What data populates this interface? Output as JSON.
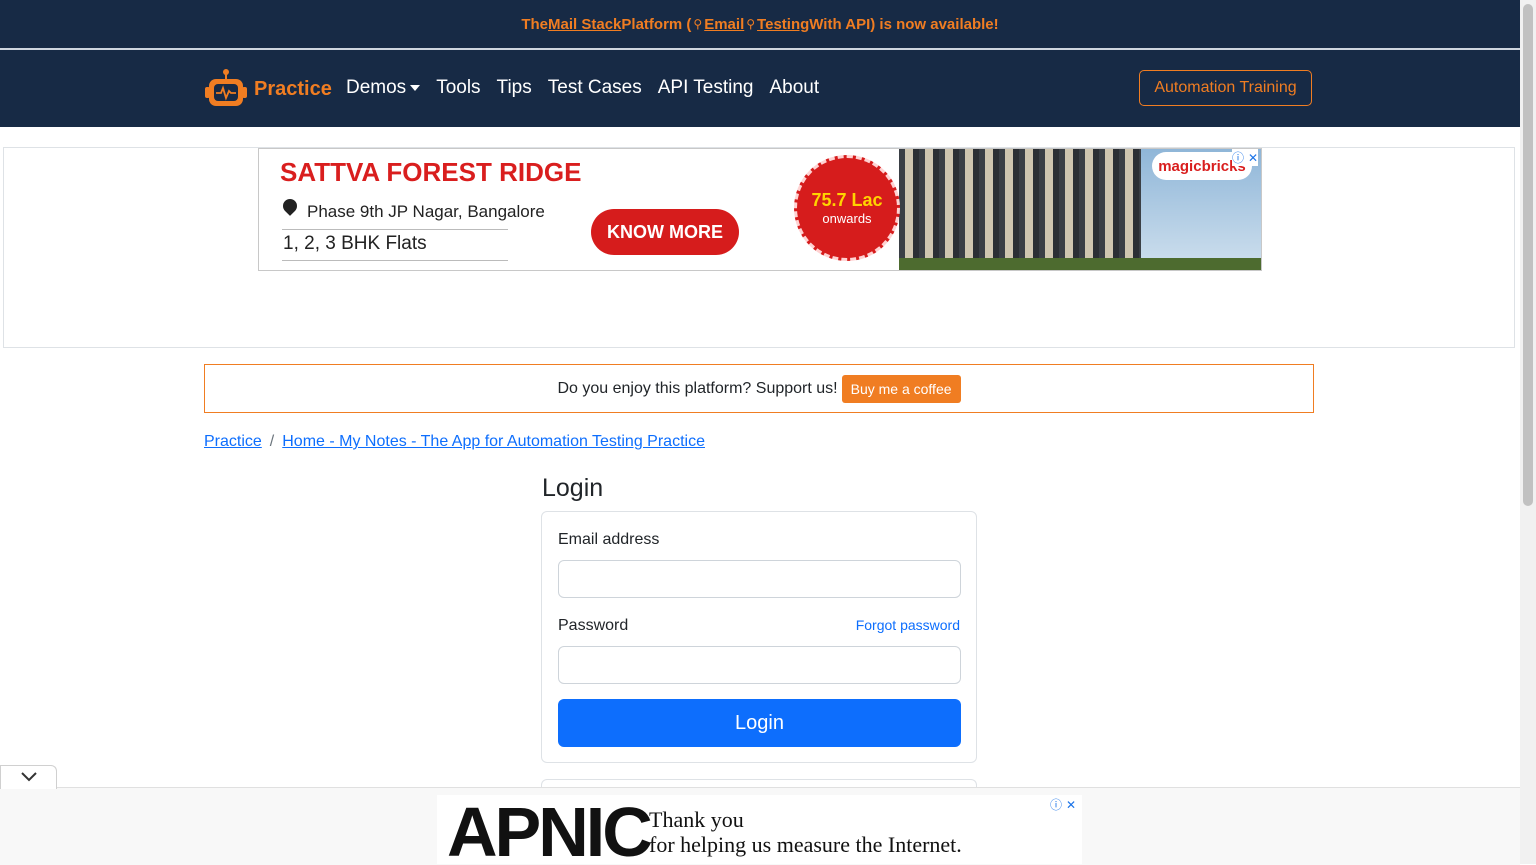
{
  "announcement": {
    "prefix": "The ",
    "link1": "Mail Stack",
    "mid1": " Platform (",
    "link2": "Email",
    "link3": "Testing",
    "suffix": " With API) is now available!"
  },
  "navbar": {
    "brand": "Practice",
    "items": [
      "Demos",
      "Tools",
      "Tips",
      "Test Cases",
      "API Testing",
      "About"
    ],
    "training": "Automation Training"
  },
  "ad": {
    "title": "SATTVA FOREST RIDGE",
    "location": "Phase 9th JP Nagar, Bangalore",
    "flats": "1, 2, 3 BHK Flats",
    "cta": "KNOW MORE",
    "price": "75.7 Lac",
    "onwards": "onwards",
    "brand": "magicbricks"
  },
  "support": {
    "text": "Do you enjoy this platform? Support us!",
    "button": "Buy me a coffee"
  },
  "breadcrumb": {
    "items": [
      "Practice",
      "Home - My Notes - The App for Automation Testing Practice"
    ],
    "separator": "/"
  },
  "login": {
    "title": "Login",
    "email_label": "Email address",
    "email_value": "",
    "password_label": "Password",
    "password_value": "",
    "forgot": "Forgot password",
    "button": "Login"
  },
  "bottom_ad": {
    "brand": "APNIC",
    "line1": "Thank you",
    "line2": "for helping us measure the Internet."
  },
  "colors": {
    "navy": "#172a45",
    "orange": "#f07d22",
    "primary": "#0d6efd"
  }
}
